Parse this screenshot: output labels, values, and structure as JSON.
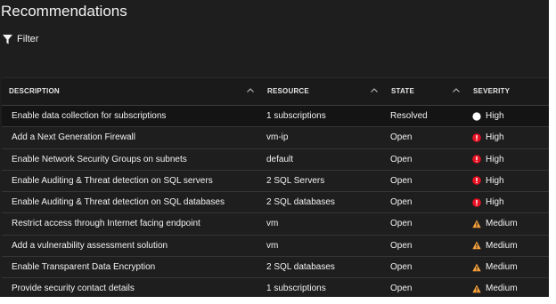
{
  "page": {
    "title": "Recommendations"
  },
  "toolbar": {
    "filter_label": "Filter"
  },
  "table": {
    "columns": {
      "description": "DESCRIPTION",
      "resource": "RESOURCE",
      "state": "STATE",
      "severity": "SEVERITY"
    },
    "rows": [
      {
        "description": "Enable data collection for subscriptions",
        "resource": "1 subscriptions",
        "state": "Resolved",
        "severity": "High",
        "severity_icon": "white-circle-icon"
      },
      {
        "description": "Add a Next Generation Firewall",
        "resource": "vm-ip",
        "state": "Open",
        "severity": "High",
        "severity_icon": "red-alert-icon"
      },
      {
        "description": "Enable Network Security Groups on subnets",
        "resource": "default",
        "state": "Open",
        "severity": "High",
        "severity_icon": "red-alert-icon"
      },
      {
        "description": "Enable Auditing & Threat detection on SQL servers",
        "resource": "2 SQL Servers",
        "state": "Open",
        "severity": "High",
        "severity_icon": "red-alert-icon"
      },
      {
        "description": "Enable Auditing & Threat detection on SQL databases",
        "resource": "2 SQL databases",
        "state": "Open",
        "severity": "High",
        "severity_icon": "red-alert-icon"
      },
      {
        "description": "Restrict access through Internet facing endpoint",
        "resource": "vm",
        "state": "Open",
        "severity": "Medium",
        "severity_icon": "orange-warning-icon"
      },
      {
        "description": "Add a vulnerability assessment solution",
        "resource": "vm",
        "state": "Open",
        "severity": "Medium",
        "severity_icon": "orange-warning-icon"
      },
      {
        "description": "Enable Transparent Data Encryption",
        "resource": "2 SQL databases",
        "state": "Open",
        "severity": "Medium",
        "severity_icon": "orange-warning-icon"
      },
      {
        "description": "Provide security contact details",
        "resource": "1 subscriptions",
        "state": "Open",
        "severity": "Medium",
        "severity_icon": "orange-warning-icon"
      }
    ]
  },
  "colors": {
    "background": "#1e1e1e",
    "high": "#e81123",
    "medium": "#f7a23c",
    "resolved": "#ffffff"
  }
}
